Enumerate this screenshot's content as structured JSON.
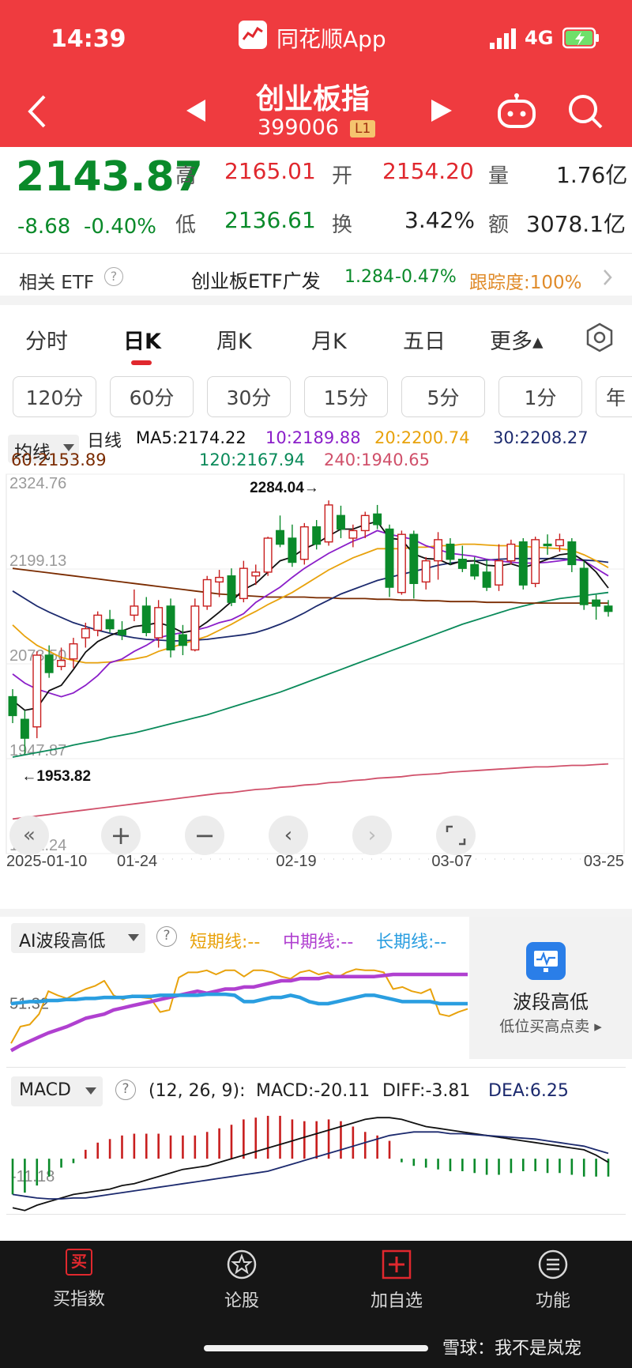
{
  "status_bar": {
    "time": "14:39",
    "app_name": "同花顺App",
    "network": "4G"
  },
  "header": {
    "title": "创业板指",
    "code": "399006",
    "level_badge": "L1"
  },
  "quote": {
    "price": "2143.87",
    "change": "-8.68",
    "change_pct": "-0.40%",
    "high_label": "高",
    "high": "2165.01",
    "open_label": "开",
    "open": "2154.20",
    "volume_label": "量",
    "volume": "1.76亿",
    "low_label": "低",
    "low": "2136.61",
    "turnover_label": "换",
    "turnover": "3.42%",
    "amount_label": "额",
    "amount": "3078.1亿"
  },
  "etf": {
    "label": "相关 ETF",
    "name": "创业板ETF广发",
    "price": "1.284",
    "change_pct": "-0.47%",
    "tracking": "跟踪度:100%"
  },
  "period_tabs": [
    "分时",
    "日K",
    "周K",
    "月K",
    "五日",
    "更多▴"
  ],
  "active_tab": "日K",
  "minute_chips": [
    "120分",
    "60分",
    "30分",
    "15分",
    "5分",
    "1分",
    "年"
  ],
  "indicator_select": "均线",
  "ma_legend": {
    "title": "日线",
    "ma5": "MA5:2174.22",
    "ma10": "10:2189.88",
    "ma20": "20:2200.74",
    "ma30": "30:2208.27",
    "ma60": "60:2153.89",
    "ma120": "120:2167.94",
    "ma240": "240:1940.65"
  },
  "colors": {
    "up": "#c81e1e",
    "down": "#0a8a2a",
    "ma5": "#111111",
    "ma10": "#8b1fc9",
    "ma20": "#e8a20c",
    "ma30": "#1c2a6e",
    "ma60": "#7a2b00",
    "ma120": "#0a8a5a",
    "ma240": "#d0506a"
  },
  "chart_data": [
    {
      "type": "candlestick",
      "ylim": [
        1822.24,
        2324.76
      ],
      "y_ticks": [
        "2324.76",
        "2199.13",
        "2073.50",
        "1947.87",
        "1822.24"
      ],
      "x_ticks": [
        "2025-01-10",
        "01-24",
        "02-19",
        "03-07",
        "03-25"
      ],
      "annotations": {
        "max": "2284.04→",
        "min": "←1953.82"
      },
      "ohlc": [
        [
          2030,
          2040,
          1995,
          2005
        ],
        [
          2000,
          2012,
          1954,
          1975
        ],
        [
          1990,
          2090,
          1975,
          2085
        ],
        [
          2085,
          2098,
          2055,
          2062
        ],
        [
          2070,
          2095,
          2065,
          2078
        ],
        [
          2080,
          2108,
          2068,
          2100
        ],
        [
          2108,
          2128,
          2095,
          2120
        ],
        [
          2118,
          2143,
          2110,
          2138
        ],
        [
          2132,
          2145,
          2115,
          2120
        ],
        [
          2118,
          2130,
          2105,
          2112
        ],
        [
          2138,
          2172,
          2130,
          2150
        ],
        [
          2150,
          2162,
          2110,
          2115
        ],
        [
          2108,
          2158,
          2095,
          2148
        ],
        [
          2150,
          2160,
          2082,
          2092
        ],
        [
          2112,
          2125,
          2085,
          2098
        ],
        [
          2092,
          2160,
          2090,
          2150
        ],
        [
          2150,
          2190,
          2145,
          2185
        ],
        [
          2182,
          2198,
          2162,
          2188
        ],
        [
          2190,
          2200,
          2150,
          2155
        ],
        [
          2160,
          2210,
          2155,
          2200
        ],
        [
          2190,
          2205,
          2178,
          2195
        ],
        [
          2195,
          2242,
          2190,
          2240
        ],
        [
          2250,
          2270,
          2228,
          2232
        ],
        [
          2240,
          2258,
          2202,
          2208
        ],
        [
          2212,
          2260,
          2205,
          2255
        ],
        [
          2255,
          2264,
          2225,
          2232
        ],
        [
          2235,
          2290,
          2230,
          2284
        ],
        [
          2270,
          2283,
          2240,
          2252
        ],
        [
          2240,
          2258,
          2228,
          2250
        ],
        [
          2250,
          2275,
          2240,
          2270
        ],
        [
          2272,
          2284,
          2252,
          2258
        ],
        [
          2252,
          2258,
          2162,
          2175
        ],
        [
          2168,
          2250,
          2165,
          2245
        ],
        [
          2245,
          2250,
          2160,
          2180
        ],
        [
          2182,
          2215,
          2172,
          2210
        ],
        [
          2210,
          2248,
          2185,
          2238
        ],
        [
          2232,
          2240,
          2205,
          2212
        ],
        [
          2212,
          2230,
          2195,
          2200
        ],
        [
          2205,
          2215,
          2185,
          2190
        ],
        [
          2195,
          2212,
          2170,
          2175
        ],
        [
          2178,
          2232,
          2170,
          2210
        ],
        [
          2210,
          2238,
          2205,
          2232
        ],
        [
          2235,
          2240,
          2172,
          2178
        ],
        [
          2180,
          2242,
          2175,
          2238
        ],
        [
          2232,
          2245,
          2218,
          2230
        ],
        [
          2230,
          2246,
          2222,
          2238
        ],
        [
          2235,
          2240,
          2195,
          2205
        ],
        [
          2200,
          2210,
          2145,
          2152
        ],
        [
          2158,
          2165,
          2132,
          2150
        ],
        [
          2150,
          2158,
          2136,
          2143
        ]
      ],
      "ma5": [
        2025,
        2012,
        2015,
        2038,
        2045,
        2066,
        2089,
        2103,
        2111,
        2117,
        2123,
        2125,
        2128,
        2123,
        2115,
        2118,
        2129,
        2142,
        2156,
        2172,
        2180,
        2195,
        2210,
        2215,
        2226,
        2233,
        2243,
        2252,
        2252,
        2258,
        2262,
        2240,
        2238,
        2219,
        2213,
        2212,
        2205,
        2210,
        2210,
        2204,
        2203,
        2206,
        2201,
        2206,
        2212,
        2218,
        2220,
        2210,
        2195,
        2174
      ],
      "ma10": [
        2060,
        2048,
        2040,
        2035,
        2030,
        2035,
        2045,
        2058,
        2075,
        2080,
        2090,
        2098,
        2108,
        2112,
        2115,
        2118,
        2122,
        2128,
        2132,
        2140,
        2155,
        2165,
        2175,
        2188,
        2200,
        2210,
        2220,
        2228,
        2236,
        2242,
        2250,
        2245,
        2242,
        2238,
        2230,
        2225,
        2220,
        2218,
        2216,
        2212,
        2210,
        2208,
        2207,
        2207,
        2208,
        2210,
        2212,
        2210,
        2200,
        2190
      ],
      "ma20": [
        2125,
        2110,
        2098,
        2090,
        2082,
        2078,
        2075,
        2075,
        2076,
        2078,
        2080,
        2083,
        2090,
        2095,
        2100,
        2105,
        2110,
        2118,
        2126,
        2135,
        2143,
        2152,
        2160,
        2168,
        2178,
        2188,
        2198,
        2206,
        2214,
        2220,
        2226,
        2226,
        2226,
        2228,
        2228,
        2230,
        2230,
        2232,
        2232,
        2231,
        2230,
        2230,
        2229,
        2228,
        2227,
        2226,
        2224,
        2218,
        2210,
        2201
      ],
      "ma30": [
        2170,
        2160,
        2150,
        2142,
        2135,
        2128,
        2123,
        2118,
        2114,
        2111,
        2108,
        2106,
        2105,
        2104,
        2104,
        2105,
        2106,
        2108,
        2110,
        2112,
        2115,
        2120,
        2126,
        2133,
        2141,
        2150,
        2158,
        2166,
        2172,
        2178,
        2184,
        2188,
        2192,
        2196,
        2200,
        2204,
        2207,
        2209,
        2210,
        2211,
        2212,
        2213,
        2213,
        2213,
        2213,
        2213,
        2212,
        2211,
        2210,
        2208
      ],
      "ma60": [
        2200,
        2198,
        2196,
        2194,
        2192,
        2190,
        2188,
        2186,
        2184,
        2182,
        2180,
        2178,
        2176,
        2174,
        2172,
        2170,
        2168,
        2166,
        2165,
        2164,
        2163,
        2162,
        2162,
        2162,
        2162,
        2161,
        2161,
        2160,
        2160,
        2160,
        2159,
        2159,
        2158,
        2158,
        2157,
        2157,
        2156,
        2156,
        2156,
        2155,
        2155,
        2155,
        2154,
        2154,
        2154,
        2154,
        2154,
        2154,
        2154,
        2154
      ],
      "ma120": [
        1950,
        1953,
        1956,
        1959,
        1962,
        1966,
        1969,
        1972,
        1976,
        1979,
        1982,
        1986,
        1990,
        1994,
        1998,
        2002,
        2006,
        2011,
        2016,
        2021,
        2026,
        2031,
        2036,
        2042,
        2048,
        2054,
        2060,
        2066,
        2072,
        2078,
        2084,
        2090,
        2096,
        2102,
        2108,
        2114,
        2120,
        2126,
        2131,
        2136,
        2141,
        2146,
        2150,
        2154,
        2157,
        2160,
        2162,
        2164,
        2166,
        2168
      ],
      "ma240": [
        1868,
        1870,
        1872,
        1874,
        1876,
        1878,
        1880,
        1882,
        1884,
        1886,
        1888,
        1890,
        1892,
        1894,
        1896,
        1898,
        1900,
        1902,
        1903,
        1905,
        1907,
        1908,
        1910,
        1911,
        1913,
        1914,
        1916,
        1917,
        1919,
        1920,
        1922,
        1923,
        1924,
        1926,
        1927,
        1928,
        1930,
        1931,
        1932,
        1933,
        1934,
        1935,
        1936,
        1937,
        1937,
        1938,
        1939,
        1939,
        1940,
        1941
      ]
    },
    {
      "type": "line",
      "title": "AI波段高低",
      "y_ticks": [
        "51.32"
      ],
      "ylim": [
        0,
        100
      ],
      "series": [
        {
          "name": "短期线:--",
          "color": "#e8a20c",
          "values": [
            12,
            28,
            30,
            40,
            62,
            58,
            55,
            60,
            64,
            67,
            72,
            58,
            54,
            58,
            56,
            55,
            42,
            44,
            75,
            80,
            80,
            82,
            78,
            82,
            82,
            76,
            82,
            82,
            80,
            76,
            74,
            80,
            82,
            78,
            80,
            75,
            80,
            83,
            82,
            82,
            80,
            64,
            66,
            62,
            60,
            64,
            40,
            38,
            42,
            45
          ]
        },
        {
          "name": "中期线:--",
          "color": "#b040d0",
          "values": [
            5,
            10,
            14,
            18,
            22,
            25,
            28,
            32,
            36,
            38,
            40,
            44,
            46,
            48,
            50,
            52,
            54,
            56,
            58,
            60,
            62,
            60,
            62,
            64,
            64,
            66,
            66,
            68,
            70,
            72,
            72,
            74,
            74,
            74,
            76,
            76,
            76,
            76,
            76,
            76,
            77,
            78,
            78,
            78,
            78,
            78,
            78,
            78,
            78,
            78
          ]
        },
        {
          "name": "长期线:--",
          "color": "#2a9ee0",
          "values": [
            50,
            51,
            52,
            52,
            53,
            53,
            54,
            54,
            55,
            55,
            56,
            56,
            56,
            57,
            57,
            57,
            58,
            58,
            58,
            58,
            58,
            59,
            59,
            59,
            58,
            52,
            52,
            54,
            56,
            56,
            58,
            56,
            52,
            50,
            50,
            52,
            54,
            56,
            58,
            58,
            56,
            54,
            52,
            52,
            52,
            52,
            50,
            50,
            50,
            50
          ]
        }
      ]
    },
    {
      "type": "bar",
      "title": "MACD",
      "params": "(12, 26, 9):",
      "macd_label": "MACD:-20.11",
      "diff_label": "DIFF:-3.81",
      "dea_label": "DEA:6.25",
      "y_ticks": [
        "-11.18"
      ],
      "ylim": [
        -60,
        55
      ],
      "values": [
        -40,
        -38,
        -30,
        -20,
        -10,
        -5,
        10,
        18,
        22,
        26,
        28,
        28,
        28,
        26,
        26,
        26,
        30,
        34,
        38,
        44,
        46,
        48,
        48,
        44,
        42,
        42,
        44,
        42,
        36,
        30,
        26,
        20,
        -4,
        -8,
        -10,
        -12,
        -14,
        -14,
        -16,
        -18,
        -18,
        -16,
        -14,
        -14,
        -16,
        -16,
        -18,
        -20,
        -20,
        -20
      ],
      "diff": [
        -55,
        -58,
        -52,
        -48,
        -44,
        -40,
        -38,
        -36,
        -34,
        -30,
        -28,
        -24,
        -20,
        -16,
        -12,
        -10,
        -8,
        -4,
        0,
        4,
        8,
        12,
        16,
        20,
        24,
        28,
        32,
        36,
        40,
        44,
        46,
        46,
        44,
        40,
        36,
        34,
        32,
        30,
        28,
        26,
        24,
        22,
        20,
        18,
        16,
        14,
        12,
        10,
        4,
        -4
      ],
      "dea": [
        -40,
        -42,
        -44,
        -45,
        -45,
        -44,
        -44,
        -42,
        -40,
        -38,
        -36,
        -34,
        -32,
        -30,
        -28,
        -26,
        -24,
        -22,
        -20,
        -18,
        -16,
        -14,
        -10,
        -6,
        -2,
        2,
        6,
        10,
        14,
        18,
        22,
        26,
        28,
        30,
        30,
        30,
        28,
        28,
        27,
        26,
        25,
        24,
        23,
        22,
        20,
        18,
        16,
        14,
        10,
        6
      ]
    }
  ],
  "wave_card": {
    "title": "波段高低",
    "subtitle": "低位买高点卖 ▸"
  },
  "bottom_nav": [
    {
      "label": "买指数",
      "icon_text": "买"
    },
    {
      "label": "论股"
    },
    {
      "label": "加自选"
    },
    {
      "label": "功能"
    }
  ],
  "watermark": "雪球：我不是岚宠"
}
